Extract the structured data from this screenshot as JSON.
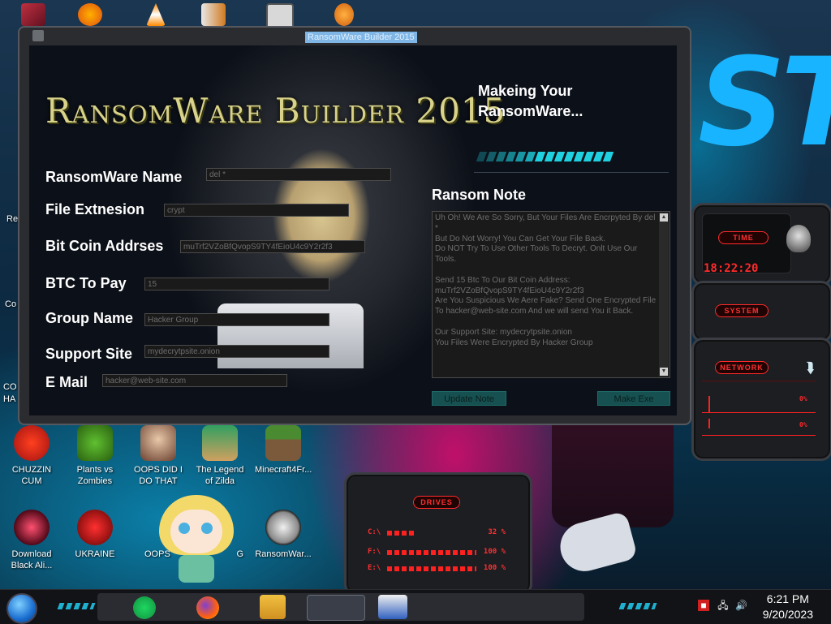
{
  "window": {
    "title": "RansomWare Builder 2015",
    "banner": "RansomWare Builder 2015",
    "status": "Makeing Your RansomWare..."
  },
  "form": {
    "name_label": "RansomWare Name",
    "name_value": "del *",
    "ext_label": "File Extnesion",
    "ext_value": "crypt",
    "btc_addr_label": "Bit Coin Addrses",
    "btc_addr_value": "muTrf2VZoBfQvopS9TY4fEioU4c9Y2r2f3",
    "btc_pay_label": "BTC To Pay",
    "btc_pay_value": "15",
    "group_label": "Group Name",
    "group_value": "Hacker Group",
    "site_label": "Support Site",
    "site_value": "mydecrytpsite.onion",
    "email_label": "E Mail",
    "email_value": "hacker@web-site.com"
  },
  "note": {
    "label": "Ransom Note",
    "lines": [
      "Uh Oh! We Are So Sorry, But Your Files Are Encrpyted By del *",
      "But Do Not Worry! You Can Get Your File Back.",
      "Do NOT Try To Use Other Tools To Decryt. Onlt Use Our Tools.",
      "",
      "Send 15 Btc To Our Bit Coin Address: muTrf2VZoBfQvopS9TY4fEioU4c9Y2r2f3",
      "Are You Suspicious We Aere Fake? Send One Encrypted File To hacker@web-site.com And we will send You it Back.",
      "",
      "Our Support Site: mydecrytpsite.onion",
      "You Files Were Encrypted By Hacker Group"
    ]
  },
  "buttons": {
    "update": "Update Note",
    "make": "Make Exe"
  },
  "desktop_icons": [
    {
      "label": "CHUZZIN CUM",
      "icon": "chuzzle-icon"
    },
    {
      "label": "Plants vs Zombies",
      "icon": "plants-vs-zombies-icon"
    },
    {
      "label": "OOPS DID I DO THAT",
      "icon": "portrait-icon"
    },
    {
      "label": "The Legend of Zilda",
      "icon": "zelda-icon"
    },
    {
      "label": "Minecraft4Fr...",
      "icon": "minecraft-icon"
    },
    {
      "label": "Download Black Ali...",
      "icon": "alien-download-icon"
    },
    {
      "label": "UKRAINE",
      "icon": "radiation-icon"
    },
    {
      "label": "OOPS",
      "icon": "oops-icon"
    },
    {
      "label": "G",
      "icon": "g-icon"
    },
    {
      "label": "RansomWar...",
      "icon": "skull-icon"
    }
  ],
  "side_labels": [
    "Re",
    "Co",
    "CO",
    "HA"
  ],
  "gadgets": {
    "time_label": "TIME",
    "time_value": "18:22:20",
    "system_label": "SYSTEM",
    "network_label": "NETWORK",
    "net_up": "0%",
    "net_down": "0%",
    "drives_label": "DRIVES",
    "drives": [
      {
        "name": "C:\\",
        "pct": "32 %",
        "level": 0.32
      },
      {
        "name": "F:\\",
        "pct": "100 %",
        "level": 1.0
      },
      {
        "name": "E:\\",
        "pct": "100 %",
        "level": 1.0
      }
    ]
  },
  "taskbar": {
    "time": "6:21 PM",
    "date": "9/20/2023"
  },
  "colors": {
    "accent_cyan": "#1fd0e0",
    "gadget_red": "#ff2a2a",
    "title_gold": "#d8d28a"
  }
}
